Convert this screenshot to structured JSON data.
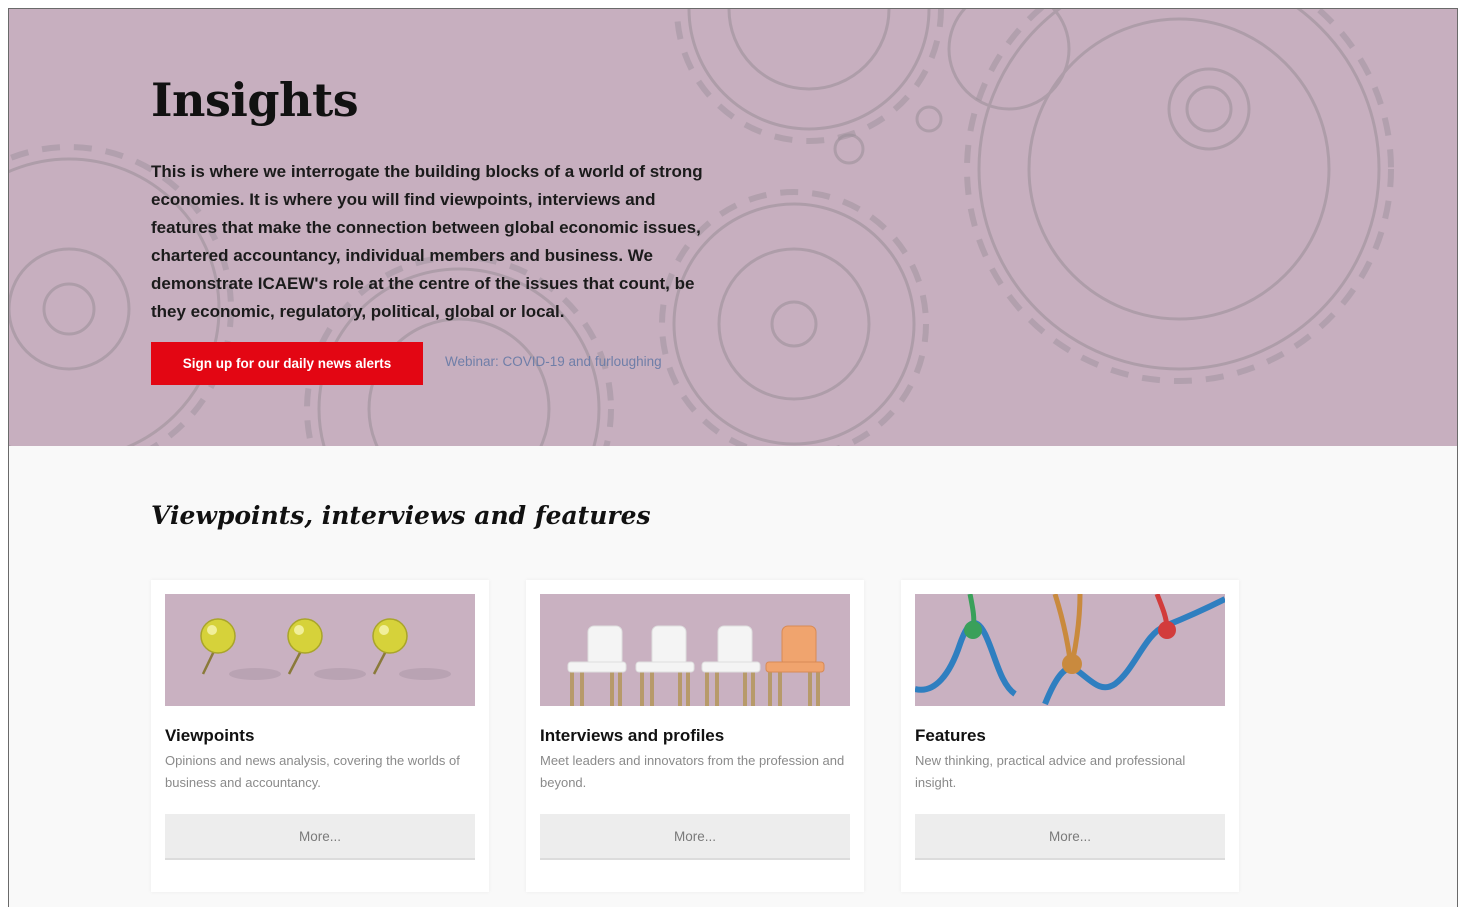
{
  "hero": {
    "title": "Insights",
    "description": "This is where we interrogate the building blocks of a world of strong economies. It is where you will find viewpoints, interviews and features that make the connection between global economic issues, chartered accountancy, individual members and business. We demonstrate ICAEW's role at the centre of the issues that count, be they economic, regulatory, political, global or local.",
    "cta_label": "Sign up for our daily news alerts",
    "link_label": "Webinar: COVID-19 and furloughing",
    "background_color": "#c7afbf"
  },
  "section": {
    "title": "Viewpoints, interviews and features"
  },
  "cards": [
    {
      "title": "Viewpoints",
      "description": "Opinions and news analysis, covering the worlds of business and accountancy.",
      "button_label": "More...",
      "image": "yellow-pushpins-image"
    },
    {
      "title": "Interviews and profiles",
      "description": "Meet leaders and innovators from the profession and beyond.",
      "button_label": "More...",
      "image": "chairs-row-image"
    },
    {
      "title": "Features",
      "description": "New thinking, practical advice and professional insight.",
      "button_label": "More...",
      "image": "knotted-ropes-image"
    }
  ],
  "colors": {
    "accent_red": "#e30613",
    "link_blue": "#6f7ea8",
    "card_image_bg": "#c9b1c1"
  }
}
